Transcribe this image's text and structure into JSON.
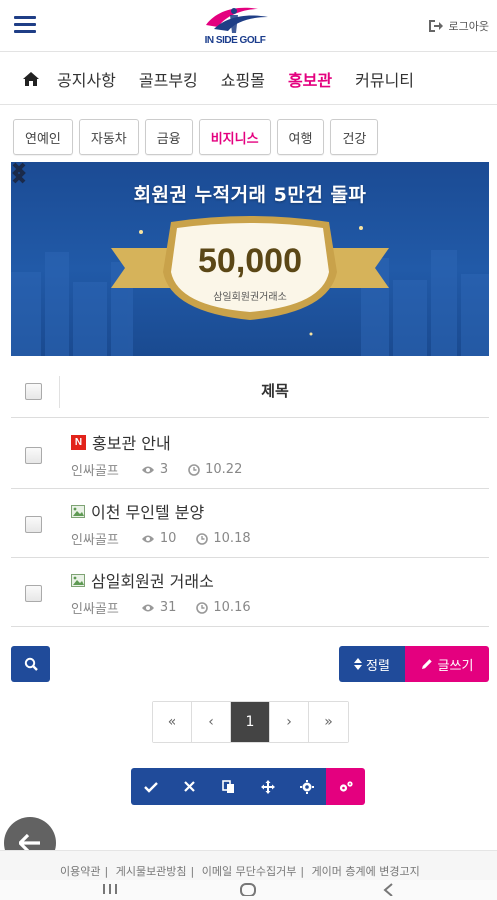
{
  "header": {
    "logo_text": "IN SIDE GOLF",
    "logout_label": "로그아웃"
  },
  "nav": {
    "items": [
      {
        "label": "공지사항",
        "active": false
      },
      {
        "label": "골프부킹",
        "active": false
      },
      {
        "label": "쇼핑몰",
        "active": false
      },
      {
        "label": "홍보관",
        "active": true
      },
      {
        "label": "커뮤니티",
        "active": false
      }
    ]
  },
  "categories": [
    {
      "label": "연예인",
      "active": false
    },
    {
      "label": "자동차",
      "active": false
    },
    {
      "label": "금융",
      "active": false
    },
    {
      "label": "비지니스",
      "active": true
    },
    {
      "label": "여행",
      "active": false
    },
    {
      "label": "건강",
      "active": false
    }
  ],
  "banner": {
    "title": "회원권 누적거래 5만건 돌파",
    "number": "50,000",
    "subtitle": "삼일회원권거래소"
  },
  "table": {
    "header_title": "제목",
    "rows": [
      {
        "title": "홍보관 안내",
        "icon": "notice-badge-icon",
        "badge": "N",
        "author": "인싸골프",
        "views": "3",
        "date": "10.22"
      },
      {
        "title": "이천 무인텔 분양",
        "icon": "image-icon",
        "author": "인싸골프",
        "views": "10",
        "date": "10.18"
      },
      {
        "title": "삼일회원권 거래소",
        "icon": "image-icon",
        "author": "인싸골프",
        "views": "31",
        "date": "10.16"
      }
    ]
  },
  "buttons": {
    "sort_label": "정렬",
    "write_label": "글쓰기"
  },
  "pagination": {
    "first": "«",
    "prev": "‹",
    "current": "1",
    "next": "›",
    "last": "»"
  },
  "footer": {
    "links": [
      "이용약관",
      "게시물보관방침",
      "이메일 무단수집거부",
      "게이머 층계에 변경고지"
    ]
  },
  "colors": {
    "primary": "#204b9a",
    "accent": "#e4007f",
    "badge": "#e2231a"
  }
}
